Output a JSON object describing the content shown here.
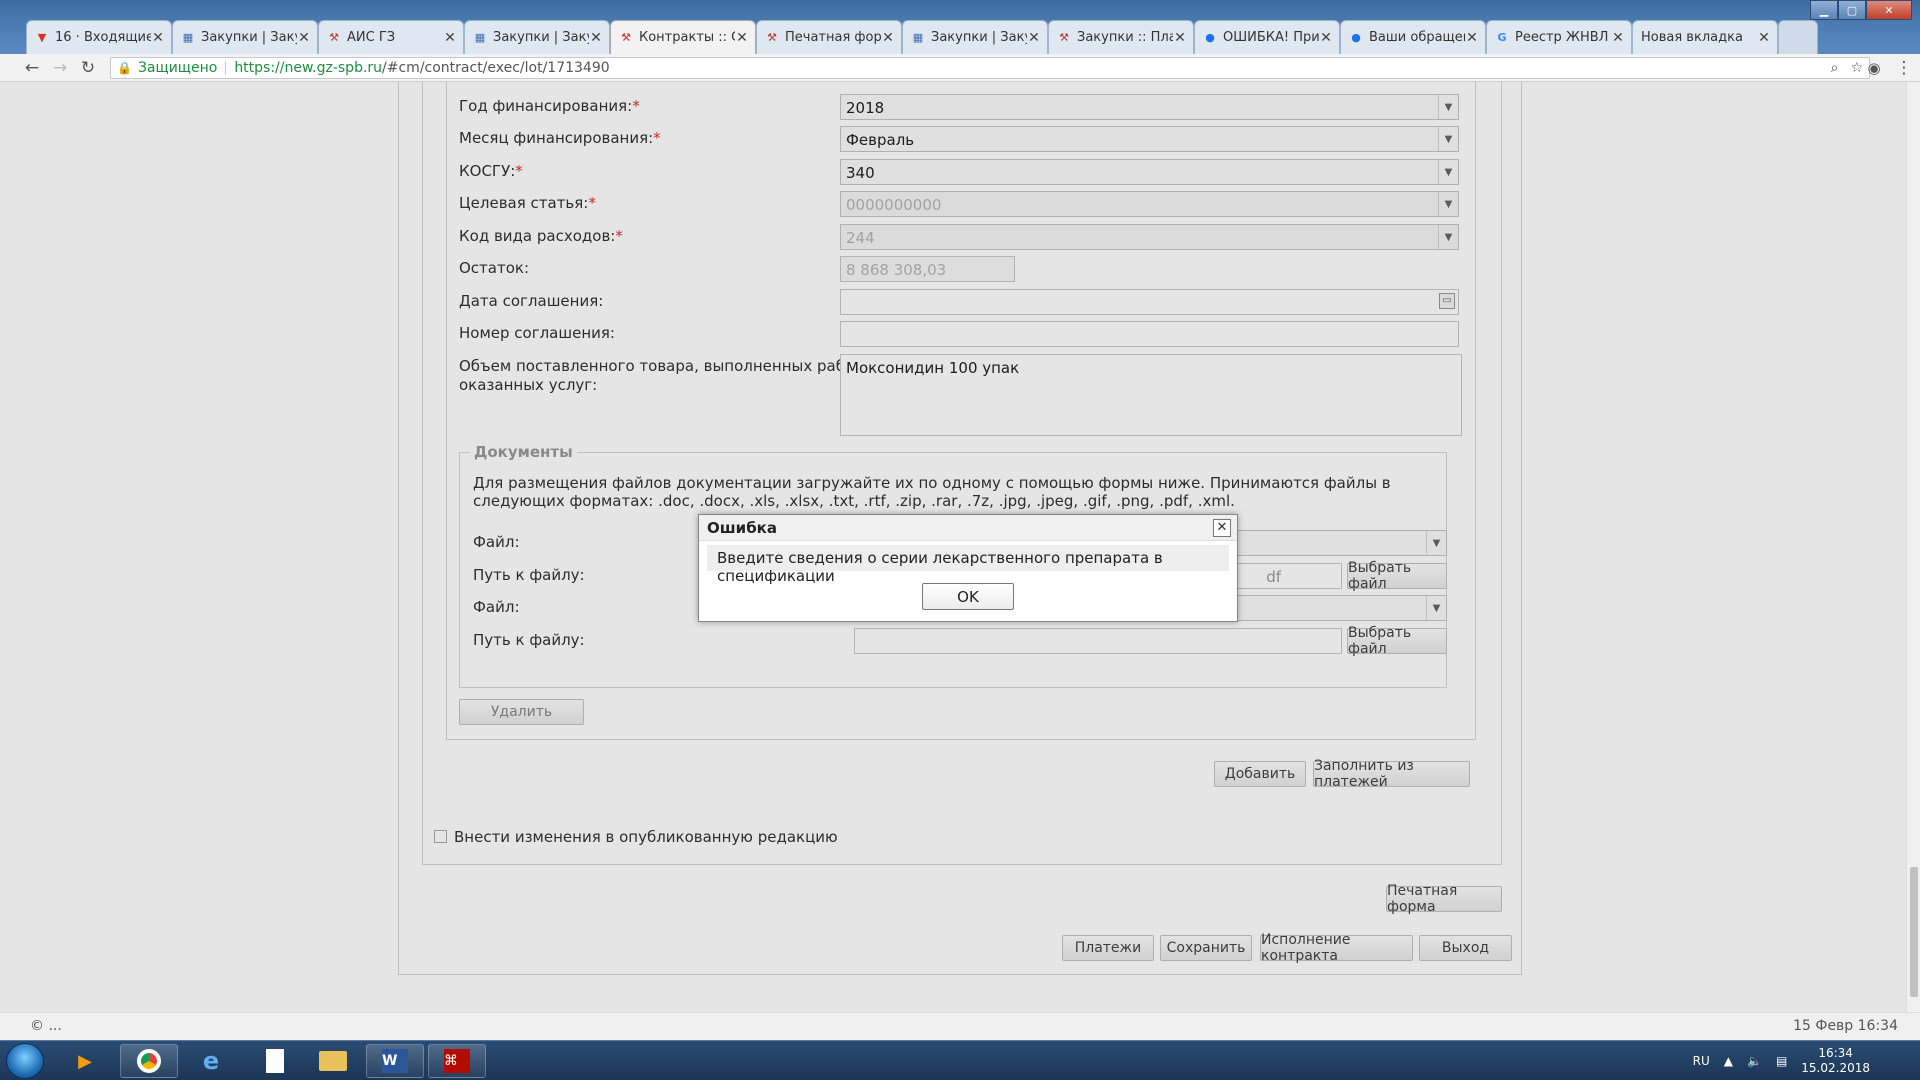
{
  "browser": {
    "tabs": [
      {
        "icon": "gmail-icon",
        "label": "16 · Входящие ·",
        "active": false
      },
      {
        "icon": "zakupki-icon",
        "label": "Закупки | Закуп",
        "active": false
      },
      {
        "icon": "ais-icon",
        "label": "АИС ГЗ",
        "active": false
      },
      {
        "icon": "zakupki-icon",
        "label": "Закупки | Закуп",
        "active": false
      },
      {
        "icon": "ais-icon",
        "label": "Контракты :: Св",
        "active": true
      },
      {
        "icon": "ais-icon",
        "label": "Печатная форм",
        "active": false
      },
      {
        "icon": "zakupki-icon",
        "label": "Закупки | Закуп",
        "active": false
      },
      {
        "icon": "ais-icon",
        "label": "Закупки :: План",
        "active": false
      },
      {
        "icon": "globe-icon",
        "label": "ОШИБКА! При",
        "active": false
      },
      {
        "icon": "globe-icon",
        "label": "Ваши обращен",
        "active": false
      },
      {
        "icon": "google-icon",
        "label": "Реестр ЖНВЛ ·",
        "active": false
      },
      {
        "icon": "none",
        "label": "Новая вкладка",
        "active": false
      }
    ],
    "secure_label": "Защищено",
    "url_host": "https://new.gz-spb.ru",
    "url_path": "/#cm/contract/exec/lot/1713490"
  },
  "form": {
    "year_label": "Год финансирования:",
    "year_value": "2018",
    "month_label": "Месяц финансирования:",
    "month_value": "Февраль",
    "kosgu_label": "КОСГУ:",
    "kosgu_value": "340",
    "target_label": "Целевая статья:",
    "target_value": "0000000000",
    "expense_label": "Код вида расходов:",
    "expense_value": "244",
    "balance_label": "Остаток:",
    "balance_value": "8 868 308,03",
    "agreement_date_label": "Дата соглашения:",
    "agreement_number_label": "Номер соглашения:",
    "volume_label_1": "Объем поставленного товара, выполненных работ,",
    "volume_label_2": "оказанных услуг:",
    "volume_value": "Моксонидин 100 упак",
    "required_mark": "*"
  },
  "documents": {
    "legend": "Документы",
    "note": "Для размещения файлов документации загружайте их по одному с помощью формы ниже. Принимаются файлы в следующих форматах: .doc, .docx, .xls, .xlsx, .txt, .rtf, .zip, .rar, .7z, .jpg, .jpeg, .gif, .png, .pdf, .xml.",
    "file_label": "Файл:",
    "path_label": "Путь к файлу:",
    "path1_value": "df",
    "choose_file": "Выбрать файл",
    "delete_button": "Удалить"
  },
  "actions": {
    "add": "Добавить",
    "fill_from_payments": "Заполнить из платежей",
    "publish_changes": "Внести изменения в опубликованную редакцию",
    "print_form": "Печатная форма",
    "payments": "Платежи",
    "save": "Сохранить",
    "execution": "Исполнение контракта",
    "exit": "Выход"
  },
  "dialog": {
    "title": "Ошибка",
    "message": "Введите сведения о серии лекарственного препарата в спецификации",
    "ok": "OK"
  },
  "statusbar": {
    "left": "© ...",
    "right": "15 Февр 16:34"
  },
  "taskbar": {
    "lang": "RU",
    "time": "16:34",
    "date": "15.02.2018"
  }
}
